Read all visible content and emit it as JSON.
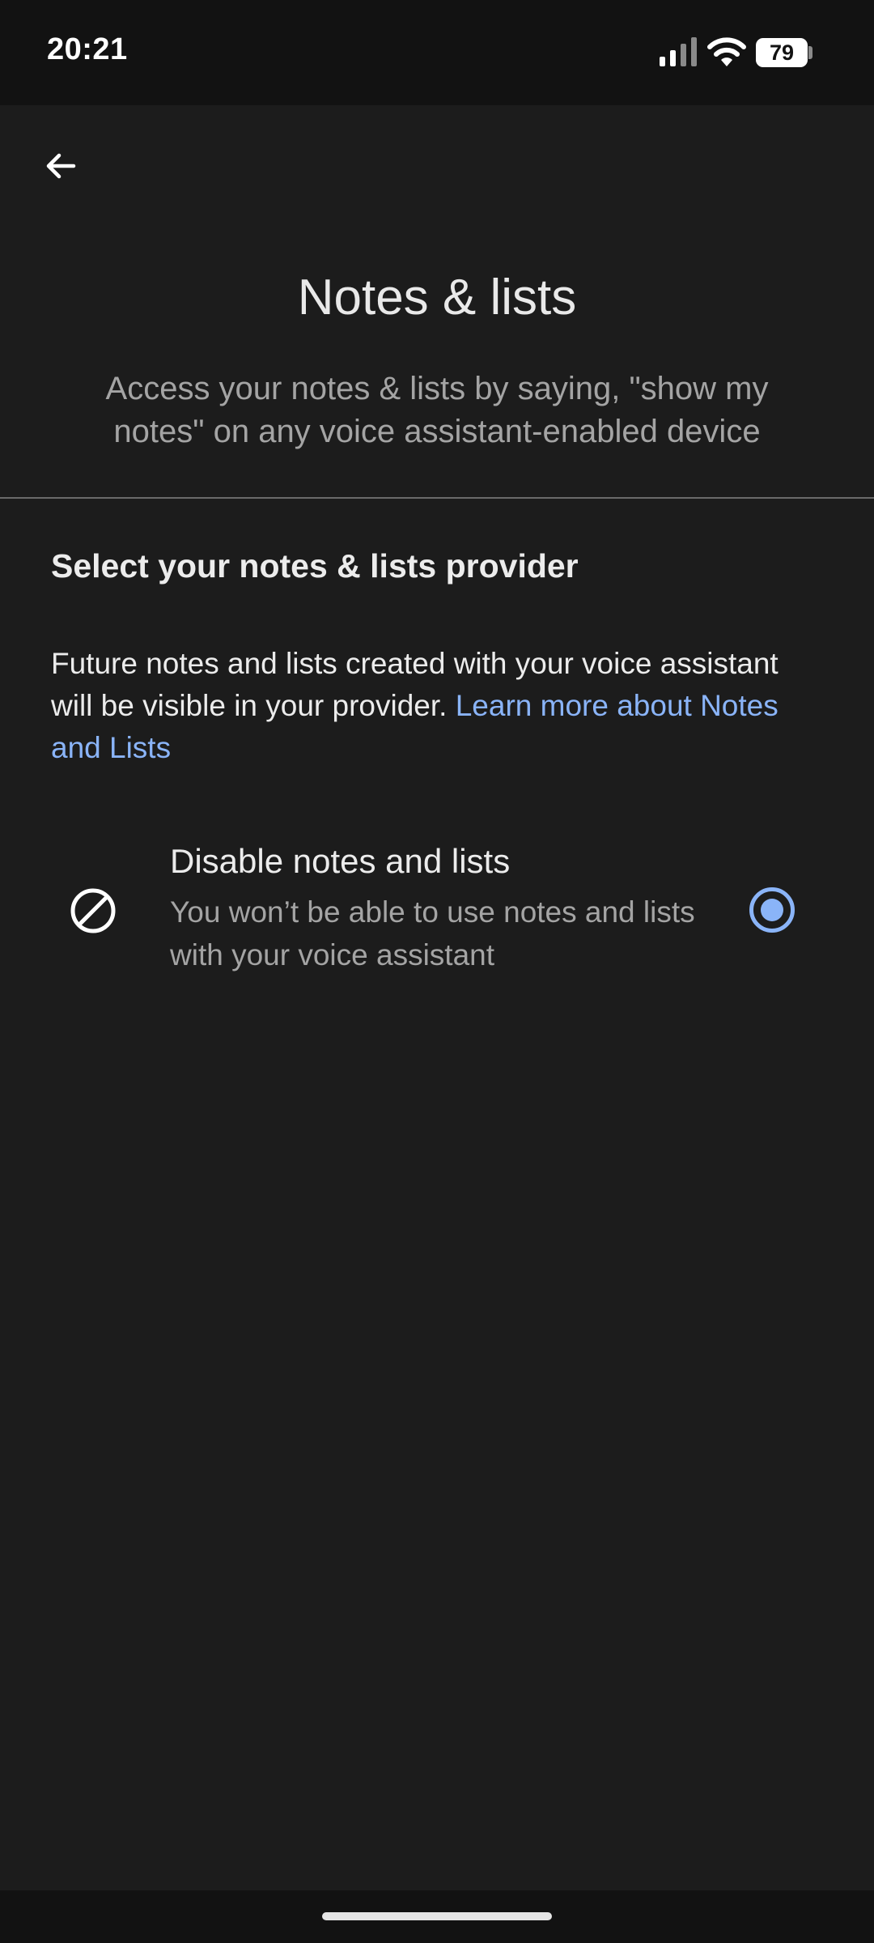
{
  "status_bar": {
    "time": "20:21",
    "battery": "79",
    "icons": [
      "signal-icon",
      "wifi-icon",
      "battery-icon"
    ]
  },
  "header": {
    "back_icon": "arrow-back-icon",
    "title": "Notes & lists",
    "subtitle": "Access your notes & lists by saying, \"show my notes\" on any voice assistant-enabled device"
  },
  "section": {
    "heading": "Select your notes & lists provider",
    "description": "Future notes and lists created with your voice assistant will be visible in your provider. ",
    "link": "Learn more about Notes and Lists"
  },
  "options": [
    {
      "icon": "block-icon",
      "title": "Disable notes and lists",
      "description": "You won’t be able to use notes and lists with your voice assistant",
      "selected": true
    }
  ],
  "colors": {
    "background": "#1c1c1c",
    "status_bar": "#121212",
    "accent": "#8ab4f8",
    "primary_text": "#ececec",
    "secondary_text": "#a4a4a4",
    "divider": "#6a6a6a"
  }
}
